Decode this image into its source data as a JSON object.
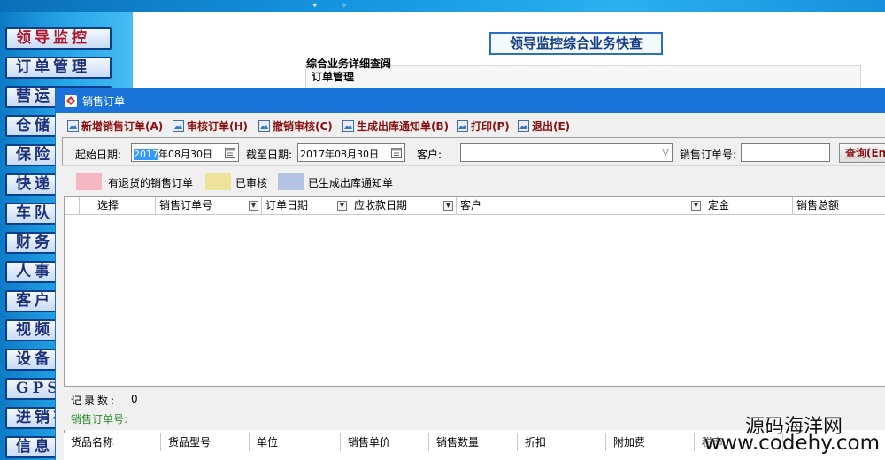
{
  "sidebar": {
    "items": [
      {
        "label": "领导监控"
      },
      {
        "label": "订单管理"
      },
      {
        "label": "营运"
      },
      {
        "label": "仓储"
      },
      {
        "label": "保险"
      },
      {
        "label": "快递"
      },
      {
        "label": "车队"
      },
      {
        "label": "财务"
      },
      {
        "label": "人事"
      },
      {
        "label": "客户"
      },
      {
        "label": "视频"
      },
      {
        "label": "设备"
      },
      {
        "label": "GPS"
      },
      {
        "label": "进销存"
      },
      {
        "label": "信息"
      }
    ]
  },
  "background_page": {
    "title": "领导监控综合业务快查",
    "section": "综合业务详细查阅",
    "subsection": "订单管理"
  },
  "dialog": {
    "title": "销售订单",
    "toolbar": {
      "new_order": "新增销售订单(A)",
      "audit_order": "审核订单(H)",
      "cancel_audit": "撤销审核(C)",
      "gen_outbound": "生成出库通知单(B)",
      "print": "打印(P)",
      "exit": "退出(E)"
    },
    "search": {
      "start_label": "起始日期:",
      "start_value_sel": "2017",
      "start_value_rest": "年08月30日",
      "end_label": "截至日期:",
      "end_value": "2017年08月30日",
      "customer_label": "客户:",
      "customer_value": "",
      "order_no_label": "销售订单号:",
      "order_no_value": "",
      "query_button": "查询(En"
    },
    "legend": [
      {
        "label": "有退货的销售订单",
        "color": "#f7b7c2"
      },
      {
        "label": "已审核",
        "color": "#efe39a"
      },
      {
        "label": "已生成出库通知单",
        "color": "#b3c3e1"
      }
    ],
    "grid": {
      "columns": [
        "选择",
        "销售订单号",
        "订单日期",
        "应收款日期",
        "客户",
        "定金",
        "销售总额"
      ]
    },
    "status": {
      "record_label": "记录数:",
      "record_count": "0",
      "order_no_label": "销售订单号:"
    },
    "detail_grid": {
      "columns": [
        "货品名称",
        "货品型号",
        "单位",
        "销售单价",
        "销售数量",
        "折扣",
        "附加费",
        "税率"
      ]
    }
  },
  "watermark": {
    "cn": "源码海洋网",
    "url": "www.codehy.com"
  },
  "colors": {
    "titlebar": "#1a73d8",
    "toolbar_text": "#8b1010",
    "sidebar_bg": "#23a3e6"
  }
}
